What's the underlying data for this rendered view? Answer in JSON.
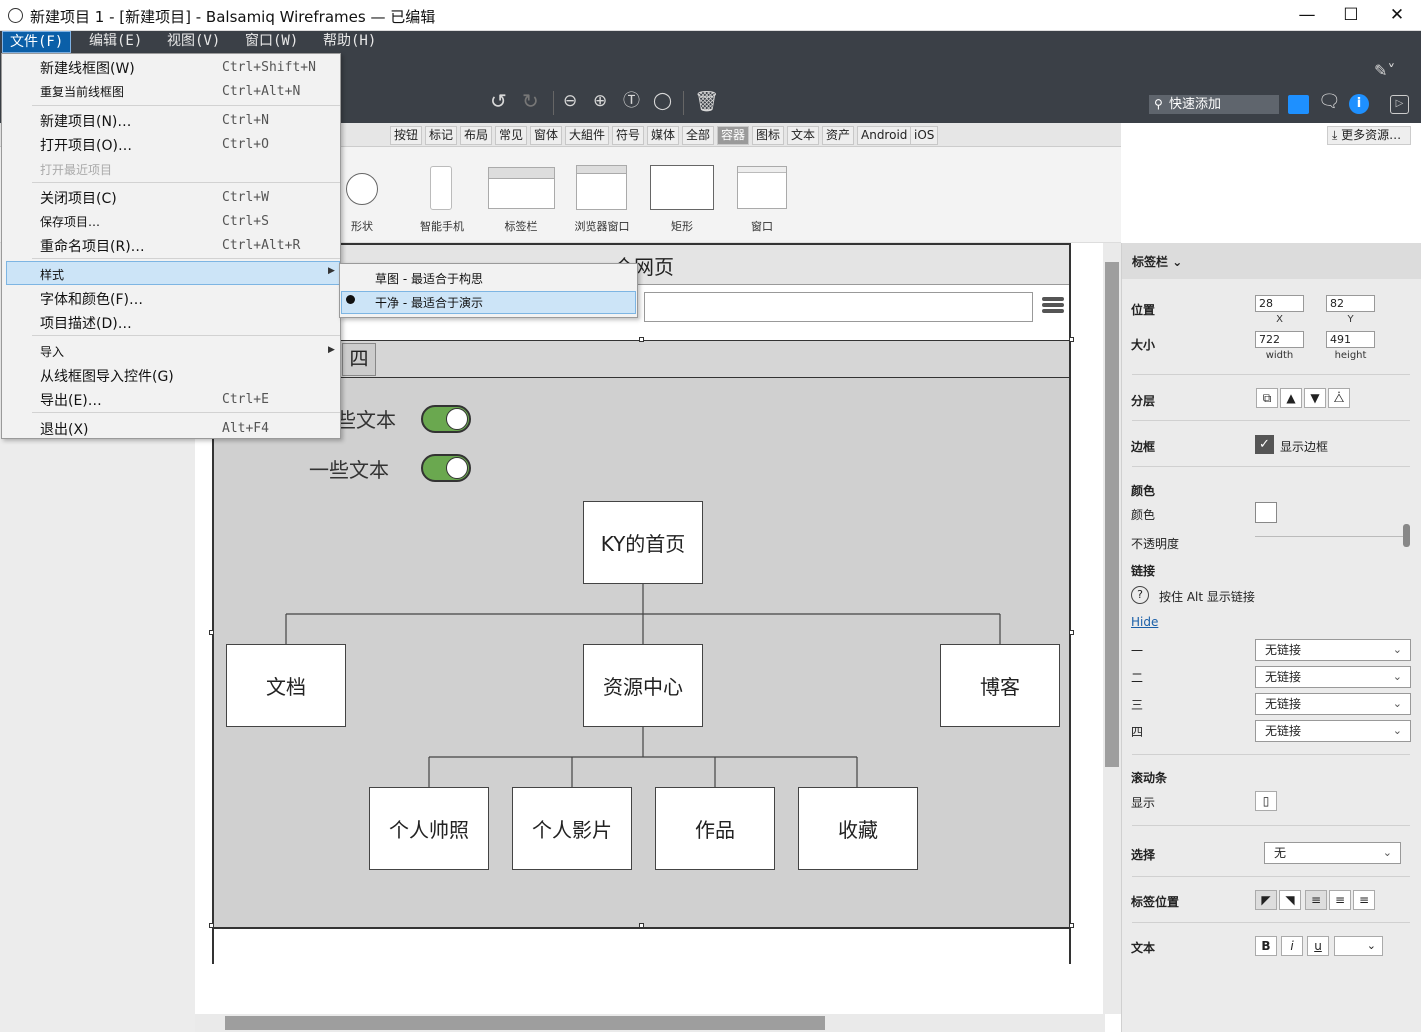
{
  "window": {
    "title": "新建项目 1 - [新建项目] - Balsamiq Wireframes — 已编辑"
  },
  "menubar": [
    "文件(F)",
    "编辑(E)",
    "视图(V)",
    "窗口(W)",
    "帮助(H)"
  ],
  "file_menu": {
    "items": [
      {
        "label": "新建线框图(W)",
        "shortcut": "Ctrl+Shift+N"
      },
      {
        "label": "重复当前线框图",
        "shortcut": "Ctrl+Alt+N"
      },
      {
        "label": "新建项目(N)…",
        "shortcut": "Ctrl+N"
      },
      {
        "label": "打开项目(O)…",
        "shortcut": "Ctrl+O"
      },
      {
        "label": "打开最近项目",
        "shortcut": ""
      },
      {
        "label": "关闭项目(C)",
        "shortcut": "Ctrl+W"
      },
      {
        "label": "保存项目…",
        "shortcut": "Ctrl+S"
      },
      {
        "label": "重命名项目(R)…",
        "shortcut": "Ctrl+Alt+R"
      },
      {
        "label": "样式",
        "shortcut": ""
      },
      {
        "label": "字体和颜色(F)…",
        "shortcut": ""
      },
      {
        "label": "项目描述(D)…",
        "shortcut": ""
      },
      {
        "label": "导入",
        "shortcut": ""
      },
      {
        "label": "从线框图导入控件(G)",
        "shortcut": ""
      },
      {
        "label": "导出(E)…",
        "shortcut": "Ctrl+E"
      },
      {
        "label": "退出(X)",
        "shortcut": "Alt+F4"
      }
    ],
    "style_submenu": [
      "草图 - 最适合于构思",
      "干净 - 最适合于演示"
    ]
  },
  "toolbar": {
    "quick_add_placeholder": "快速添加"
  },
  "library_tabs": [
    "按钮",
    "标记",
    "布局",
    "常见",
    "窗体",
    "大組件",
    "符号",
    "媒体",
    "全部",
    "容器",
    "图标",
    "文本",
    "资产",
    "Android",
    "iOS"
  ],
  "library_active_tab": "容器",
  "more_resources": "更多资源…",
  "library_items": [
    "形状",
    "智能手机",
    "标签栏",
    "浏览器窗口",
    "矩形",
    "窗口"
  ],
  "wireframe": {
    "page_title": "一个网页",
    "tab_label": "四",
    "toggle_text_1": "些文本",
    "toggle_text_2": "一些文本",
    "nodes": {
      "root": "KY的首页",
      "l1": [
        "文档",
        "资源中心",
        "博客"
      ],
      "l2": [
        "个人帅照",
        "个人影片",
        "作品",
        "收藏"
      ]
    }
  },
  "inspector": {
    "header": "标签栏",
    "position_label": "位置",
    "x": "28",
    "y": "82",
    "x_label": "X",
    "y_label": "Y",
    "size_label": "大小",
    "width": "722",
    "height": "491",
    "width_label": "width",
    "height_label": "height",
    "layer_label": "分层",
    "border_label": "边框",
    "show_border": "显示边框",
    "color_section": "颜色",
    "color_label": "颜色",
    "opacity_label": "不透明度",
    "link_section": "链接",
    "alt_hint": "按住 Alt 显示链接",
    "hide": "Hide",
    "link_rows": [
      {
        "label": "一",
        "value": "无链接"
      },
      {
        "label": "二",
        "value": "无链接"
      },
      {
        "label": "三",
        "value": "无链接"
      },
      {
        "label": "四",
        "value": "无链接"
      }
    ],
    "scrollbar_section": "滚动条",
    "show_label": "显示",
    "selection_label": "选择",
    "selection_value": "无",
    "tab_position_label": "标签位置",
    "text_label": "文本",
    "bold": "B",
    "italic": "i",
    "underline": "u"
  },
  "colors": {
    "chrome": "#3b4047",
    "menu_active": "#0b5fa8",
    "toggle_on": "#6aa84f",
    "highlight": "#cce4f7",
    "info_blue": "#1e90ff"
  }
}
